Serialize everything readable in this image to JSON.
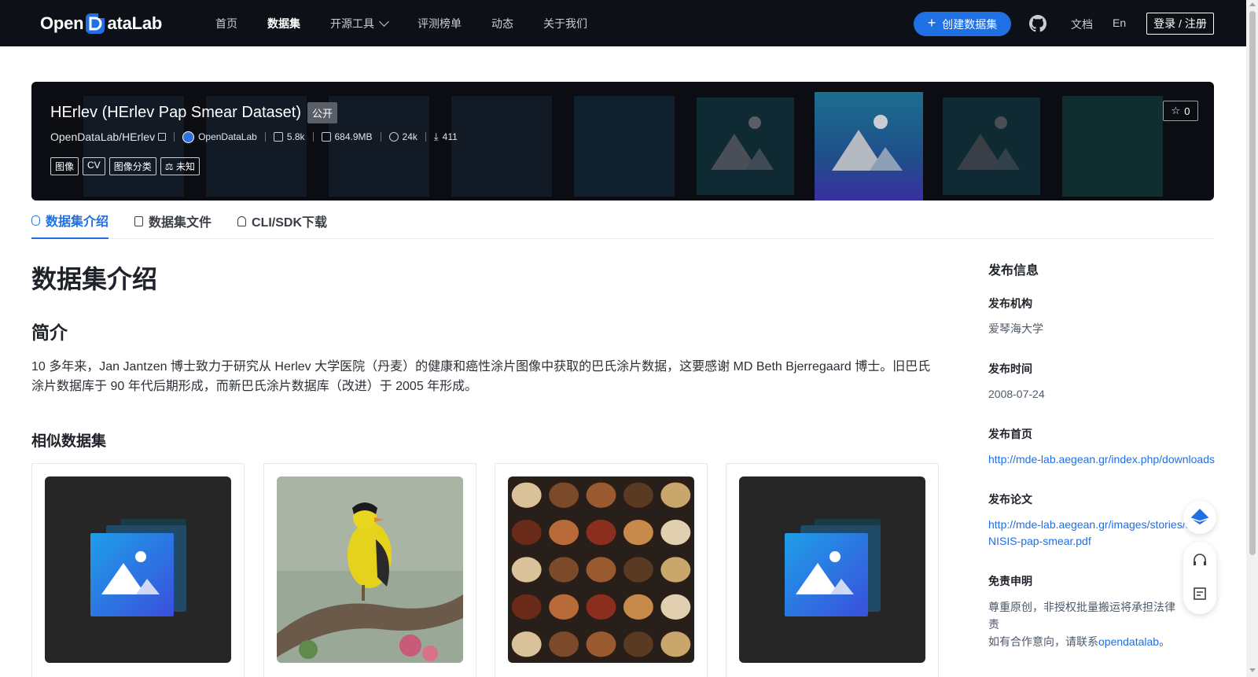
{
  "nav": {
    "logo_text_pre": "Open",
    "logo_text_post": "ataLab",
    "links": [
      "首页",
      "数据集",
      "开源工具",
      "评测榜单",
      "动态",
      "关于我们"
    ],
    "active_index": 1,
    "create_label": "创建数据集",
    "docs_label": "文档",
    "lang_label": "En",
    "login_label": "登录 / 注册",
    "accent": "#1f6fe5"
  },
  "banner": {
    "title": "HErlev (HErlev Pap Smear Dataset)",
    "visibility": "公开",
    "star_count": "0",
    "path": "OpenDataLab/HErlev",
    "org": "OpenDataLab",
    "files": "5.8k",
    "size": "684.9MB",
    "views": "24k",
    "downloads": "411",
    "tags": [
      "图像",
      "CV",
      "图像分类",
      "未知"
    ]
  },
  "tabs": [
    "数据集介绍",
    "数据集文件",
    "CLI/SDK下载"
  ],
  "main": {
    "h1": "数据集介绍",
    "h2": "简介",
    "intro": "10 多年来，Jan Jantzen 博士致力于研究从 Herlev 大学医院（丹麦）的健康和癌性涂片图像中获取的巴氏涂片数据，这要感谢 MD Beth Bjerregaard 博士。旧巴氏涂片数据库于 90 年代后期形成，而新巴氏涂片数据库（改进）于 2005 年形成。",
    "similar_title": "相似数据集"
  },
  "sidebar": {
    "title": "发布信息",
    "org_label": "发布机构",
    "org_value": "爱琴海大学",
    "time_label": "发布时间",
    "time_value": "2008-07-24",
    "home_label": "发布首页",
    "home_value": "http://mde-lab.aegean.gr/index.php/downloads",
    "paper_label": "发布论文",
    "paper_value_1": "http://mde-lab.aegean.gr/images/stories/docs/",
    "paper_value_2": "NISIS-pap-smear.pdf",
    "disclaimer_label": "免责申明",
    "disclaimer_1": "尊重原创，非授权批量搬运将承担法律责",
    "disclaimer_2": "如有合作意向，请联系",
    "disclaimer_link": "opendatalab",
    "disclaimer_end": "。"
  }
}
